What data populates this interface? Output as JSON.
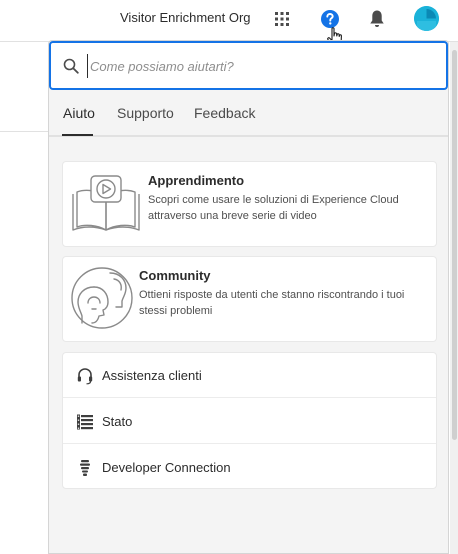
{
  "header": {
    "org_name": "Visitor Enrichment Org",
    "icons": [
      "apps-grid-icon",
      "help-icon",
      "bell-icon",
      "avatar"
    ],
    "help_color": "#1473e6",
    "avatar_color": "#1ab2d9"
  },
  "search": {
    "placeholder": "Come possiamo aiutarti?",
    "value": ""
  },
  "tabs": [
    {
      "label": "Aiuto",
      "active": true
    },
    {
      "label": "Supporto",
      "active": false
    },
    {
      "label": "Feedback",
      "active": false
    }
  ],
  "cards": [
    {
      "title": "Apprendimento",
      "description": "Scopri come usare le soluzioni di Experience Cloud attraverso una breve serie di video",
      "icon": "video-book-icon"
    },
    {
      "title": "Community",
      "description": "Ottieni risposte da utenti che stanno riscontrando i tuoi stessi problemi",
      "icon": "community-heads-icon"
    }
  ],
  "links": [
    {
      "label": "Assistenza clienti",
      "icon": "headset-icon"
    },
    {
      "label": "Stato",
      "icon": "status-list-icon"
    },
    {
      "label": "Developer Connection",
      "icon": "bulb-icon"
    }
  ],
  "colors": {
    "accent": "#1473e6",
    "panel_bg": "#f4f4f4"
  }
}
